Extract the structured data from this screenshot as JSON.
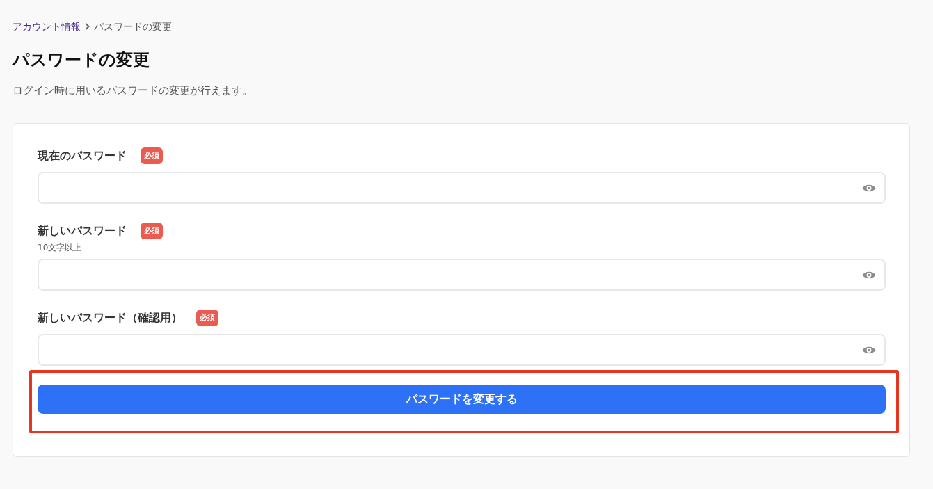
{
  "breadcrumb": [
    {
      "label": "アカウント情報",
      "kind": "link"
    },
    {
      "label": "パスワードの変更",
      "kind": "current"
    }
  ],
  "page": {
    "title": "パスワードの変更",
    "description": "ログイン時に用いるパスワードの変更が行えます。"
  },
  "form": {
    "fields": [
      {
        "label": "現在のパスワード",
        "badge": "必須"
      },
      {
        "label": "新しいパスワード",
        "badge": "必須",
        "hint": "10文字以上"
      },
      {
        "label": "新しいパスワード（確認用）",
        "badge": "必須"
      }
    ],
    "submit_button": {
      "label": "パスワードを変更する",
      "highlighted": true
    }
  }
}
